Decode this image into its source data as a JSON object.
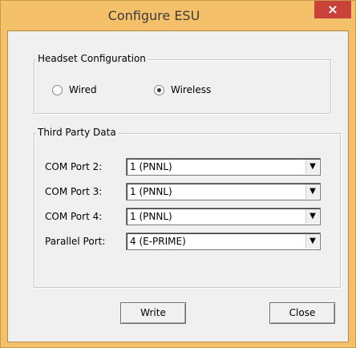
{
  "window": {
    "title": "Configure ESU",
    "close_glyph": "×"
  },
  "headset": {
    "label": "Headset Configuration",
    "options": [
      {
        "label": "Wired",
        "checked": false
      },
      {
        "label": "Wireless",
        "checked": true
      }
    ]
  },
  "third_party": {
    "label": "Third Party Data",
    "ports": [
      {
        "label": "COM Port 2:",
        "value": "1 (PNNL)"
      },
      {
        "label": "COM Port 3:",
        "value": "1 (PNNL)"
      },
      {
        "label": "COM Port 4:",
        "value": "1 (PNNL)"
      },
      {
        "label": "Parallel Port:",
        "value": "4 (E-PRIME)"
      }
    ],
    "dropdown_glyph": "▼"
  },
  "buttons": {
    "write": "Write",
    "close": "Close"
  }
}
